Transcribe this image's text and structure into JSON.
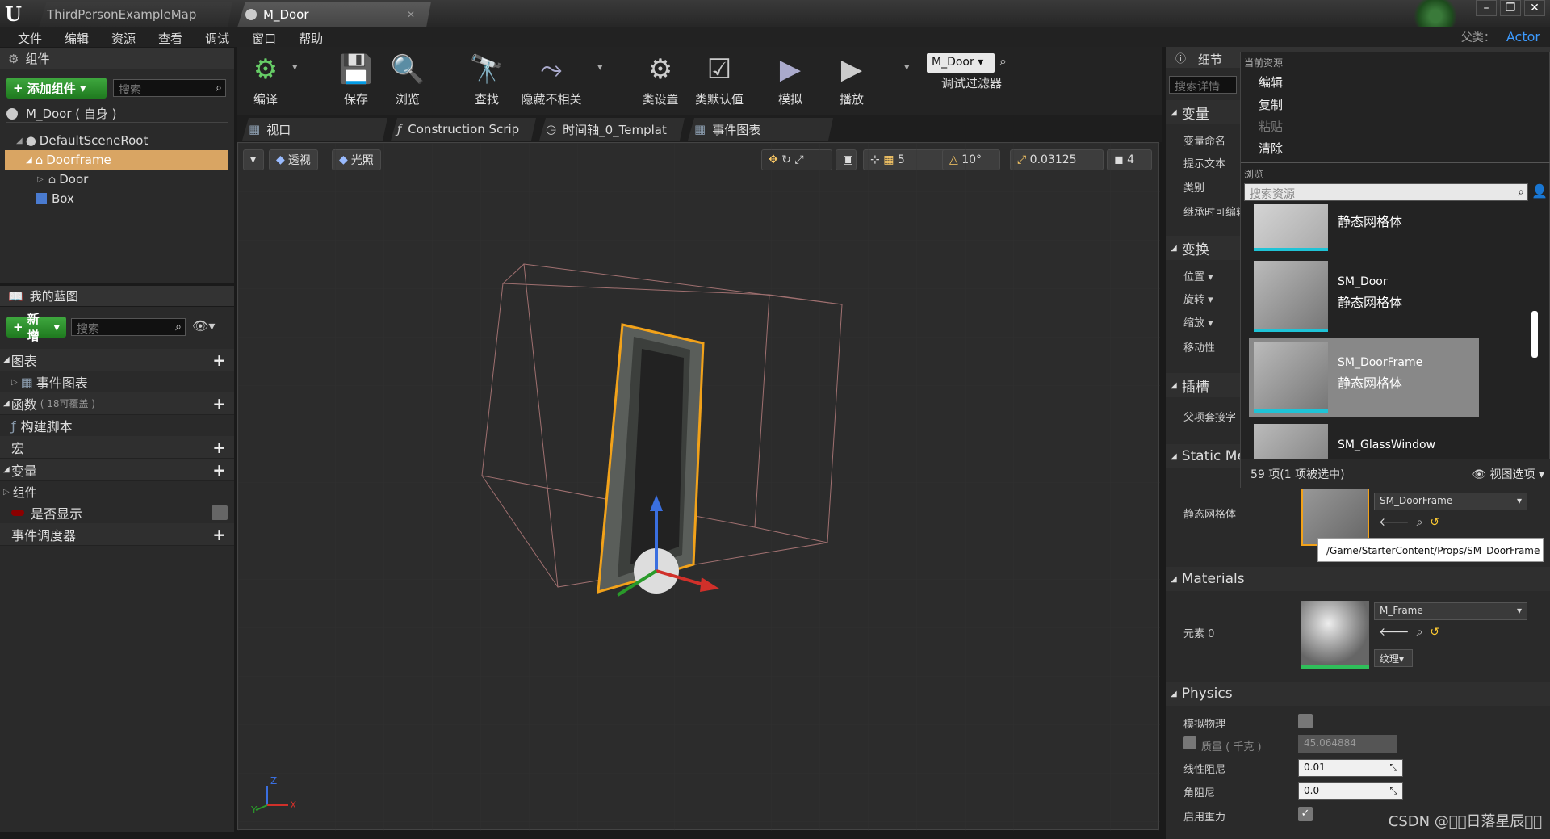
{
  "titlebar": {
    "tabs": [
      {
        "label": "ThirdPersonExampleMap"
      },
      {
        "label": "M_Door"
      }
    ]
  },
  "menubar": {
    "items": [
      "文件",
      "编辑",
      "资源",
      "查看",
      "调试",
      "窗口",
      "帮助"
    ],
    "parent_label": "父类：",
    "parent_value": "Actor"
  },
  "components": {
    "title": "组件",
    "add_label": "添加组件",
    "search_placeholder": "搜索",
    "self_label": "M_Door ( 自身 )",
    "tree": [
      "DefaultSceneRoot",
      "Doorframe",
      "Door",
      "Box"
    ]
  },
  "my_blueprint": {
    "title": "我的蓝图",
    "new_label": "新增",
    "search_placeholder": "搜索",
    "sections": {
      "graphs": "图表",
      "event_graph": "事件图表",
      "functions": "函数",
      "functions_note": "( 18可覆盖 )",
      "construction": "构建脚本",
      "macros": "宏",
      "variables": "变量",
      "components": "组件",
      "is_visible": "是否显示",
      "dispatchers": "事件调度器"
    }
  },
  "toolbar": {
    "compile": "编译",
    "save": "保存",
    "browse": "浏览",
    "find": "查找",
    "hide": "隐藏不相关",
    "class_settings": "类设置",
    "class_defaults": "类默认值",
    "simulate": "模拟",
    "play": "播放",
    "debug_object": "M_Door",
    "debug_filter": "调试过滤器"
  },
  "viewport_tabs": [
    "视口",
    "Construction Scrip",
    "时间轴_0_Templat",
    "事件图表"
  ],
  "viewport": {
    "perspective": "透视",
    "lit": "光照",
    "grid": "5",
    "angle": "10°",
    "scale": "0.03125",
    "speed": "4"
  },
  "details": {
    "title": "细节",
    "search_placeholder": "搜索详情",
    "sections": {
      "variable": "变量",
      "transform": "变换",
      "sockets": "插槽",
      "static_mesh": "Static Me",
      "materials": "Materials",
      "physics": "Physics"
    },
    "labels": {
      "var_name": "变量命名",
      "tooltip": "提示文本",
      "category": "类别",
      "inherit": "继承时可编辑",
      "location": "位置",
      "rotation": "旋转",
      "scale": "缩放",
      "mobility": "移动性",
      "parent_socket": "父项套接字",
      "static_mesh": "静态网格体",
      "element0": "元素 0",
      "simulate_physics": "模拟物理",
      "mass": "质量 ( 千克 )",
      "linear_damping": "线性阻尼",
      "angular_damping": "角阻尼",
      "enable_gravity": "启用重力"
    },
    "values": {
      "mesh": "SM_DoorFrame",
      "mesh_path": "/Game/StarterContent/Props/SM_DoorFrame",
      "material": "M_Frame",
      "texture": "纹理",
      "mass": "45.064884",
      "linear_damping": "0.01",
      "angular_damping": "0.0"
    }
  },
  "picker": {
    "current_asset": "当前资源",
    "edit": "编辑",
    "copy": "复制",
    "paste": "粘贴",
    "clear": "清除",
    "browse": "浏览",
    "search_placeholder": "搜索资源",
    "assets": [
      {
        "name": "",
        "type": "静态网格体"
      },
      {
        "name": "SM_Door",
        "type": "静态网格体"
      },
      {
        "name": "SM_DoorFrame",
        "type": "静态网格体"
      },
      {
        "name": "SM_GlassWindow",
        "type": "静态网格体"
      }
    ],
    "count": "59 项(1 项被选中)",
    "view_options": "视图选项"
  },
  "watermark": "CSDN @\u0000\u0000日落星辰\u0000\u0000"
}
